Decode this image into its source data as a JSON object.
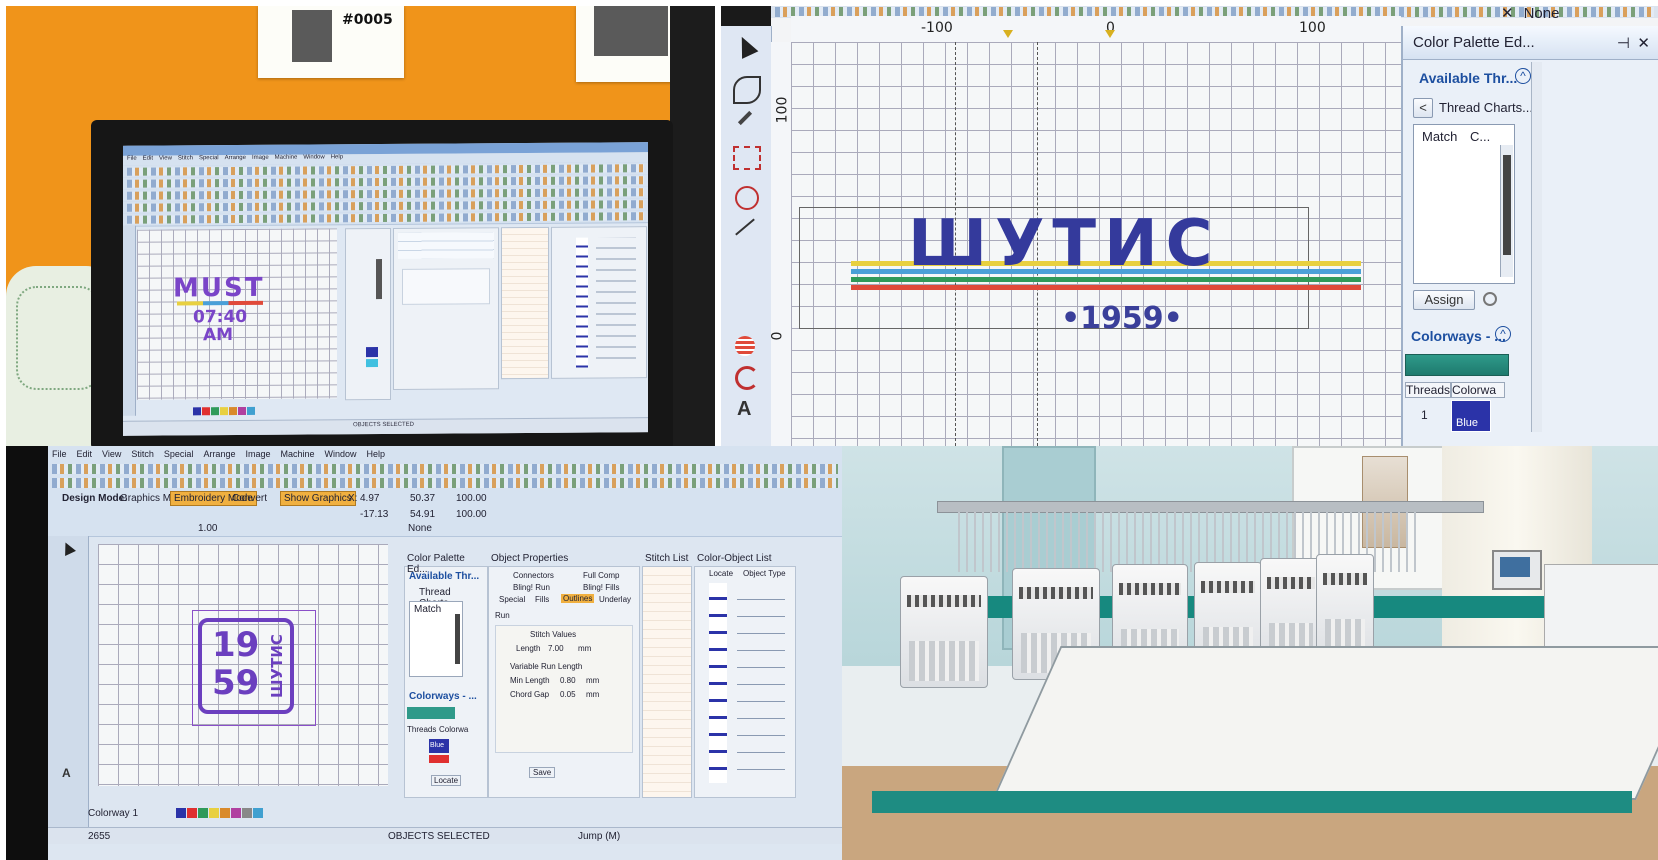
{
  "panel1": {
    "photo_card_number": "#0005",
    "design_line1": "MUST",
    "design_line2": "07:40",
    "design_line3": "AM",
    "app_menu": [
      "File",
      "Edit",
      "View",
      "Stitch",
      "Special",
      "Arrange",
      "Image",
      "Machine",
      "Window",
      "Help"
    ],
    "status_text": "OBJECTS SELECTED"
  },
  "panel2": {
    "ruler_labels": [
      "-100",
      "0",
      "100"
    ],
    "ruler_left_label": "100",
    "ruler_left_zero": "0",
    "design_text": "ШУТИС",
    "design_year": "•1959•",
    "stripe_colors": [
      "#e8d040",
      "#4aa0d8",
      "#2f9a5a",
      "#e04a3a",
      "#3a3fa0"
    ],
    "top_right_label": "None",
    "color_palette_title": "Color Palette Ed...",
    "available_threads": "Available Thr...",
    "thread_charts": "Thread Charts...",
    "match_label": "Match",
    "code_label": "C...",
    "assign_button": "Assign",
    "colorways_title": "Colorways - ...",
    "threads_col": "Threads",
    "colorway_col": "Colorwa",
    "thread_row_num": "1",
    "thread_color": "Blue",
    "accent_blue": "#2b33a8"
  },
  "panel3": {
    "app_menu": [
      "File",
      "Edit",
      "View",
      "Stitch",
      "Special",
      "Arrange",
      "Image",
      "Machine",
      "Window",
      "Help"
    ],
    "design_mode": "Design Mode:",
    "graphics_mode": "Graphics Mode",
    "embroidery_mode": "Embroidery Mode",
    "convert": "Convert",
    "show_graphics": "Show Graphics",
    "none_label": "None",
    "badge_top": "19",
    "badge_bottom": "59",
    "badge_side": "ШУТИС",
    "color_palette_title": "Color Palette Ed...",
    "available_threads": "Available Thr...",
    "thread_charts": "Thread Charts...",
    "match_label": "Match",
    "colorways": "Colorways - ...",
    "threads_col": "Threads",
    "colorway_col": "Colorwa",
    "blue_label": "Blue",
    "object_properties": "Object Properties",
    "connectors": "Connectors",
    "full_comp": "Full Comp",
    "bling_run": "Bling! Run",
    "bling_fills": "Bling! Fills",
    "special": "Special",
    "fills": "Fills",
    "outlines": "Outlines",
    "underlay": "Underlay",
    "run_label": "Run",
    "stitch_values": "Stitch Values",
    "length_label": "Length",
    "length_value": "7.00",
    "mm": "mm",
    "variable_run_length": "Variable Run Length",
    "min_length_label": "Min Length",
    "min_length_value": "0.80",
    "chord_gap_label": "Chord Gap",
    "chord_gap_value": "0.05",
    "stitch_list": "Stitch List",
    "color_object_list": "Color-Object List",
    "locate": "Locate",
    "object_type": "Object Type",
    "save": "Save",
    "colorway_status": "Colorway 1",
    "status_text": "OBJECTS SELECTED",
    "jump_text": "Jump (M)",
    "x_label": "X:",
    "x_value": "4.97",
    "y_value": "-17.13",
    "w_value": "50.37",
    "h_value": "54.91",
    "pct1": "100.00",
    "pct2": "100.00",
    "zoom": "1.00",
    "stitch_count": "2655",
    "palette_colors": [
      "#2b33a8",
      "#e03030",
      "#2f9a5a",
      "#e8d040",
      "#d98a2b",
      "#b040a0",
      "#888888",
      "#40a0d0"
    ]
  },
  "panel4": {}
}
